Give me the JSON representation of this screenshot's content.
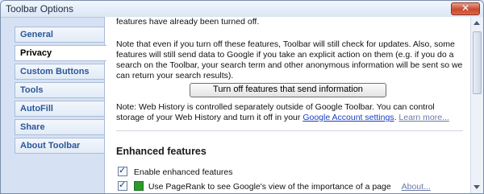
{
  "window": {
    "title": "Toolbar Options",
    "close_label": "✕"
  },
  "sidebar": {
    "items": [
      {
        "label": "General"
      },
      {
        "label": "Privacy",
        "active": true
      },
      {
        "label": "Custom Buttons"
      },
      {
        "label": "Tools"
      },
      {
        "label": "AutoFill"
      },
      {
        "label": "Share"
      },
      {
        "label": "About Toolbar"
      }
    ]
  },
  "content": {
    "top_fragment": "features have already been turned off.",
    "note1_a": "Note that even if you turn off these features, Toolbar will still check for updates. Also, some features will still send data to Google if you take an explicit action on them (e.g. if you do a search on the Toolbar, your search term and other anonymous information will be sent so we can return your search results).",
    "button_label": "Turn off features that send information",
    "note2_a": "Note: Web History is controlled separately outside of Google Toolbar. You can control storage of your Web History and turn it off in your",
    "note2_link": "Google Account settings",
    "note2_learn": "Learn more...",
    "enhanced_heading": "Enhanced features",
    "enable_label": "Enable enhanced features",
    "enable_checked": true,
    "pagerank_label": "Use PageRank to see Google's view of the importance of a page",
    "pagerank_checked": true,
    "pagerank_about": "About..."
  }
}
